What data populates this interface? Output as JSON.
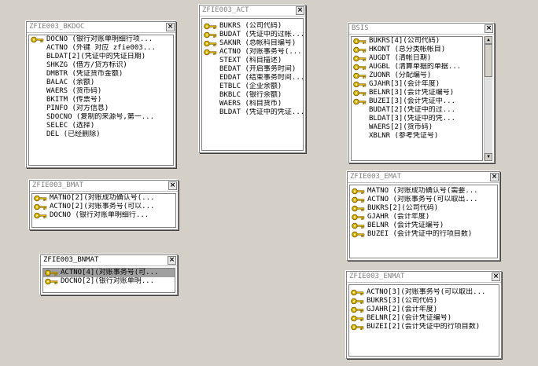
{
  "tables": [
    {
      "id": "bkdoc",
      "title": "ZFIE003_BKDOC",
      "fields": [
        {
          "key": true,
          "text": "DOCNO (银行对账单明细行项..."
        },
        {
          "key": false,
          "text": "ACTNO (外键 对应 zfie003..."
        },
        {
          "key": false,
          "text": "BLDAT[2](凭证中的凭证日期)"
        },
        {
          "key": false,
          "text": "SHKZG (借方/贷方标识)"
        },
        {
          "key": false,
          "text": "DMBTR (凭证货币金额)"
        },
        {
          "key": false,
          "text": "BALAC (余额)"
        },
        {
          "key": false,
          "text": "WAERS (货币码)"
        },
        {
          "key": false,
          "text": "BKITM (传票号)"
        },
        {
          "key": false,
          "text": "PINFO (对方信息)"
        },
        {
          "key": false,
          "text": "SDOCNO (复制的来源号,第一..."
        },
        {
          "key": false,
          "text": "SELEC (选择)"
        },
        {
          "key": false,
          "text": "DEL (已经删除)"
        }
      ]
    },
    {
      "id": "act",
      "title": "ZFIE003_ACT",
      "fields": [
        {
          "key": true,
          "text": "BUKRS (公司代码)"
        },
        {
          "key": true,
          "text": "BUDAT (凭证中的过帐..."
        },
        {
          "key": true,
          "text": "SAKNR (总帐科目编号)"
        },
        {
          "key": true,
          "text": "ACTNO (对账事务号(..."
        },
        {
          "key": false,
          "text": "STEXT (科目描述)"
        },
        {
          "key": false,
          "text": "BEDAT (开启事务时间)"
        },
        {
          "key": false,
          "text": "EDDAT (结束事务时间..."
        },
        {
          "key": false,
          "text": "ETBLC (企业余额)"
        },
        {
          "key": false,
          "text": "BKBLC (银行余额)"
        },
        {
          "key": false,
          "text": "WAERS (科目货币)"
        },
        {
          "key": false,
          "text": "BLDAT (凭证中的凭证..."
        }
      ]
    },
    {
      "id": "bsis",
      "title": "BSIS",
      "fields": [
        {
          "key": true,
          "text": "BUKRS[4](公司代码)"
        },
        {
          "key": true,
          "text": "HKONT (总分类帐帐目)"
        },
        {
          "key": true,
          "text": "AUGDT (清帐日期)"
        },
        {
          "key": true,
          "text": "AUGBL (清算单据的单据..."
        },
        {
          "key": true,
          "text": "ZUONR (分配编号)"
        },
        {
          "key": true,
          "text": "GJAHR[3](会计年度)"
        },
        {
          "key": true,
          "text": "BELNR[3](会计凭证编号)"
        },
        {
          "key": true,
          "text": "BUZEI[3](会计凭证中..."
        },
        {
          "key": false,
          "text": "BUDAT[2](凭证中的过..."
        },
        {
          "key": false,
          "text": "BLDAT[3](凭证中的凭..."
        },
        {
          "key": false,
          "text": "WAERS[2](货币码)"
        },
        {
          "key": false,
          "text": "XBLNR (参考凭证号)"
        }
      ]
    },
    {
      "id": "bmat",
      "title": "ZFIE003_BMAT",
      "fields": [
        {
          "key": true,
          "text": "MATNO[2](对账成功确认号(..."
        },
        {
          "key": true,
          "text": "ACTNO[2](对账事务号(可以..."
        },
        {
          "key": true,
          "text": "DOCNO (银行对账单明细行..."
        }
      ]
    },
    {
      "id": "emat",
      "title": "ZFIE003_EMAT",
      "fields": [
        {
          "key": true,
          "text": "MATNO (对账成功确认号(需要..."
        },
        {
          "key": true,
          "text": "ACTNO (对账事务号(可以取出..."
        },
        {
          "key": true,
          "text": "BUKRS[2](公司代码)"
        },
        {
          "key": true,
          "text": "GJAHR (会计年度)"
        },
        {
          "key": true,
          "text": "BELNR (会计凭证编号)"
        },
        {
          "key": true,
          "text": "BUZEI (会计凭证中的行项目数)"
        }
      ]
    },
    {
      "id": "bnmat",
      "title": "ZFIE003_BNMAT",
      "fields": [
        {
          "key": true,
          "text": "ACTNO[4](对账事务号(可..."
        },
        {
          "key": true,
          "text": "DOCNO[2](银行对账单明..."
        }
      ]
    },
    {
      "id": "enmat",
      "title": "ZFIE003_ENMAT",
      "fields": [
        {
          "key": true,
          "text": "ACTNO[3](对账事务号(可以取出..."
        },
        {
          "key": true,
          "text": "BUKRS[3](公司代码)"
        },
        {
          "key": true,
          "text": "GJAHR[2](会计年度)"
        },
        {
          "key": true,
          "text": "BELNR[2](会计凭证编号)"
        },
        {
          "key": true,
          "text": "BUZEI[2](会计凭证中的行项目数)"
        }
      ]
    }
  ],
  "close_glyph": "×",
  "scroll_up_glyph": "▲",
  "scroll_down_glyph": "▼",
  "key_icon": "key-icon",
  "colors": {
    "background": "#d4d0c8",
    "key_gold": "#d8b400",
    "selected_row": "#a0a0a0"
  }
}
